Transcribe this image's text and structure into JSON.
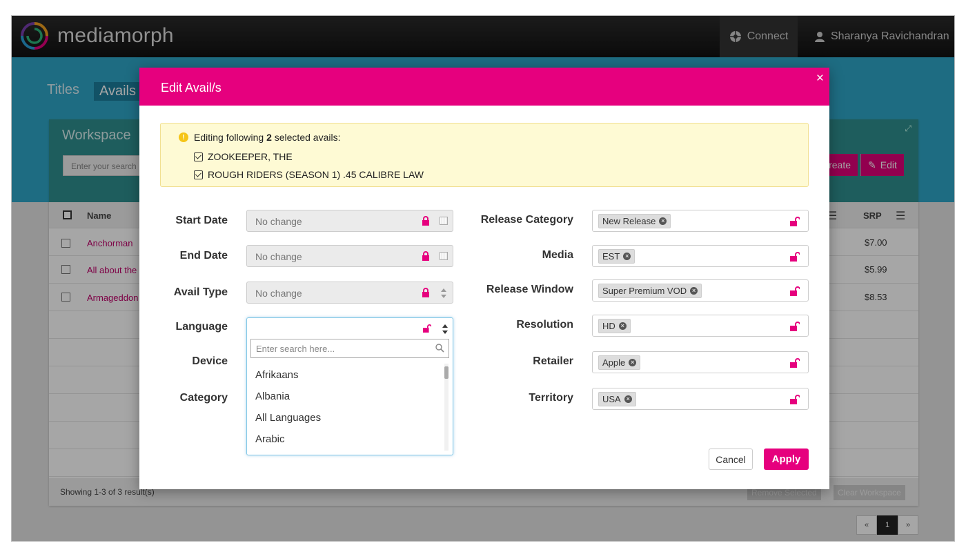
{
  "app": {
    "brand": "mediamorph",
    "connect_label": "Connect",
    "user_name": "Sharanya Ravichandran"
  },
  "nav": {
    "tabs": [
      {
        "label": "Titles"
      },
      {
        "label": "Avails"
      }
    ]
  },
  "workspace": {
    "title": "Workspace",
    "search_placeholder": "Enter your search",
    "create_label": "Create",
    "edit_label": "Edit",
    "columns": {
      "name": "Name",
      "srp": "SRP"
    },
    "rows": [
      {
        "name": "Anchorman",
        "srp": "$7.00"
      },
      {
        "name": "All about the",
        "srp": "$5.99"
      },
      {
        "name": "Armageddon",
        "srp": "$8.53"
      }
    ],
    "footer_status": "Showing 1-3 of 3 result(s)",
    "remove_selected_label": "Remove Selected",
    "clear_workspace_label": "Clear Workspace",
    "pager": {
      "prev": "«",
      "current": "1",
      "next": "»"
    }
  },
  "modal": {
    "title": "Edit Avail/s",
    "close_glyph": "×",
    "notice": {
      "prefix": "Editing following",
      "count": "2",
      "suffix": "selected avails:",
      "items": [
        "ZOOKEEPER, THE",
        "ROUGH RIDERS (SEASON 1) .45 CALIBRE LAW"
      ]
    },
    "left_fields": {
      "start_date": {
        "label": "Start Date",
        "value": "No change"
      },
      "end_date": {
        "label": "End Date",
        "value": "No change"
      },
      "avail_type": {
        "label": "Avail Type",
        "value": "No change"
      },
      "language": {
        "label": "Language"
      },
      "device": {
        "label": "Device"
      },
      "category": {
        "label": "Category"
      }
    },
    "language_dropdown": {
      "search_placeholder": "Enter search here...",
      "options": [
        "Afrikaans",
        "Albania",
        "All Languages",
        "Arabic"
      ]
    },
    "right_fields": [
      {
        "label": "Release Category",
        "tag": "New Release"
      },
      {
        "label": "Media",
        "tag": "EST"
      },
      {
        "label": "Release Window",
        "tag": "Super Premium VOD"
      },
      {
        "label": "Resolution",
        "tag": "HD"
      },
      {
        "label": "Retailer",
        "tag": "Apple"
      },
      {
        "label": "Territory",
        "tag": "USA"
      }
    ],
    "cancel_label": "Cancel",
    "apply_label": "Apply"
  },
  "colors": {
    "accent": "#e6007e",
    "teal": "#2fa7c8",
    "workspace_head": "#2e8f8f"
  },
  "icons": [
    "logo-mark",
    "aperture-icon",
    "user-icon",
    "pencil-icon",
    "expand-icon",
    "close-icon",
    "warning-icon",
    "checkbox-checked-icon",
    "lock-icon",
    "calendar-icon",
    "sort-updown-icon",
    "unlock-icon",
    "remove-tag-icon",
    "search-icon",
    "menu-icon"
  ]
}
